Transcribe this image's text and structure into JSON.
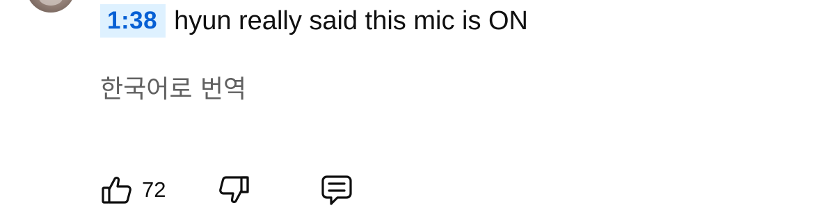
{
  "comment": {
    "timestamp": "1:38",
    "text": "hyun really said this mic is ON",
    "translate_label": "한국어로 번역"
  },
  "actions": {
    "like_count": "72",
    "like_icon": "thumbs-up-icon",
    "dislike_icon": "thumbs-down-icon",
    "reply_icon": "comment-icon"
  },
  "colors": {
    "timestamp_text": "#065fd4",
    "timestamp_bg": "#def1ff",
    "text": "#0f0f0f",
    "secondary_text": "#606060"
  }
}
